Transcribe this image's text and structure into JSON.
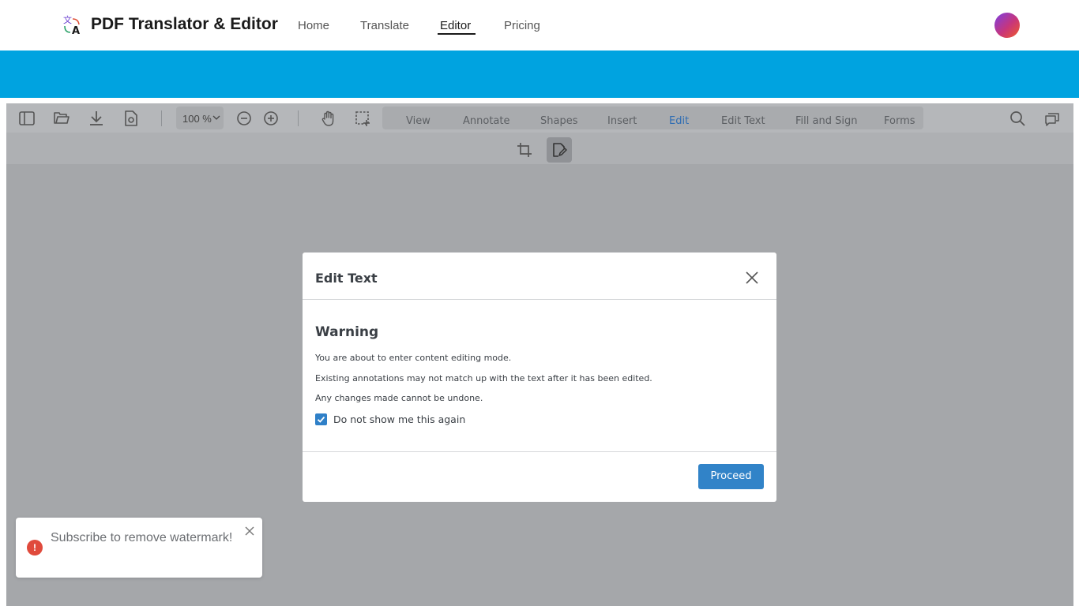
{
  "header": {
    "brand": "PDF Translator & Editor",
    "logo_icon": "translate-icon",
    "nav": [
      {
        "label": "Home"
      },
      {
        "label": "Translate"
      },
      {
        "label": "Editor",
        "active": true
      },
      {
        "label": "Pricing"
      }
    ],
    "avatar_colors": [
      "#7b3fe4",
      "#c8367a",
      "#f05a28"
    ]
  },
  "banner": {
    "color": "#00a3e0"
  },
  "viewer": {
    "toolbar": {
      "left_icons": [
        "sidebar-icon",
        "open-folder-icon",
        "download-icon",
        "document-settings-icon"
      ],
      "zoom": "100 %",
      "zoom_icons": [
        "zoom-out-icon",
        "zoom-in-icon"
      ],
      "tool_icons": [
        "pan-hand-icon",
        "select-region-icon"
      ],
      "tabs": [
        {
          "label": "View"
        },
        {
          "label": "Annotate"
        },
        {
          "label": "Shapes"
        },
        {
          "label": "Insert"
        },
        {
          "label": "Edit",
          "active": true
        },
        {
          "label": "Edit Text"
        },
        {
          "label": "Fill and Sign"
        },
        {
          "label": "Forms"
        }
      ],
      "right_icons": [
        "search-icon",
        "comments-icon"
      ]
    },
    "subtoolbar": {
      "icons": [
        {
          "name": "crop-icon"
        },
        {
          "name": "edit-text-icon",
          "active": true
        }
      ]
    }
  },
  "modal": {
    "title": "Edit Text",
    "heading": "Warning",
    "messages": [
      "You are about to enter content editing mode.",
      "Existing annotations may not match up with the text after it has been edited.",
      "Any changes made cannot be undone."
    ],
    "checkbox_label": "Do not show me this again",
    "checkbox_checked": true,
    "proceed_label": "Proceed",
    "accent": "#3183c8"
  },
  "toast": {
    "text": "Subscribe to remove watermark!",
    "icon": "error-icon",
    "icon_glyph": "!",
    "color": "#e04a3c"
  }
}
